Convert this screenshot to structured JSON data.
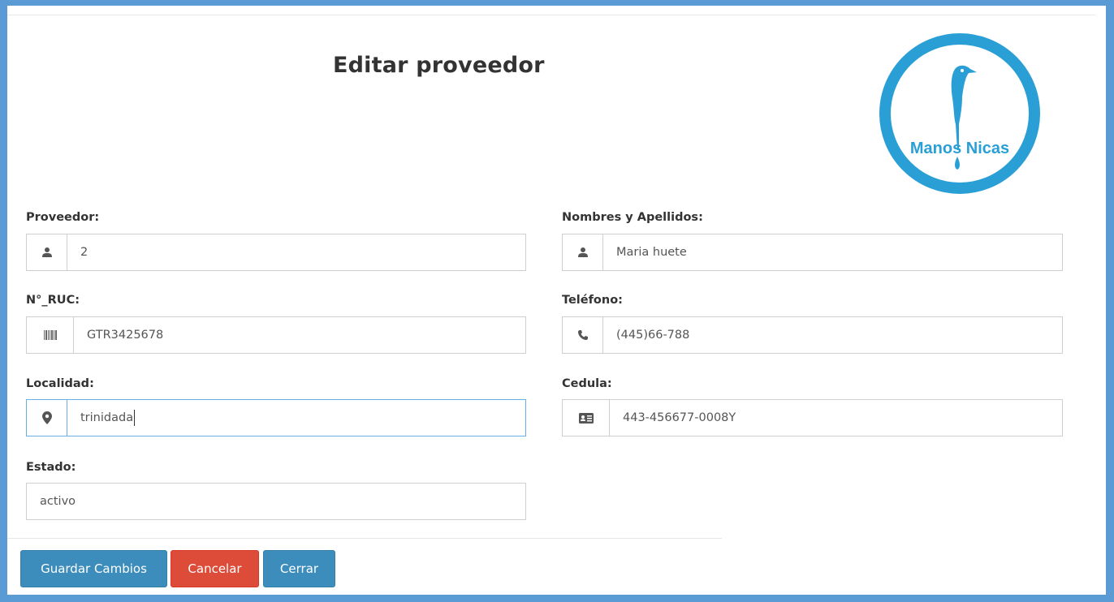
{
  "header": {
    "title": "Editar proveedor",
    "logo_text": "Manos Nicas"
  },
  "form": {
    "proveedor": {
      "label": "Proveedor:",
      "value": "2",
      "icon": "user-icon"
    },
    "nombres": {
      "label": "Nombres y Apellidos:",
      "value": "Maria huete",
      "icon": "user-icon"
    },
    "ruc": {
      "label": "N°_RUC:",
      "value": "GTR3425678",
      "icon": "barcode-icon"
    },
    "telefono": {
      "label": "Teléfono:",
      "value": "(445)66-788",
      "icon": "phone-icon"
    },
    "localidad": {
      "label": "Localidad:",
      "value": "trinidada",
      "icon": "map-marker-icon"
    },
    "cedula": {
      "label": "Cedula:",
      "value": "443-456677-0008Y",
      "icon": "id-card-icon"
    },
    "estado": {
      "label": "Estado:",
      "value": "activo"
    }
  },
  "buttons": {
    "save": "Guardar Cambios",
    "cancel": "Cancelar",
    "close": "Cerrar"
  },
  "colors": {
    "frame": "#5b9bd5",
    "primary": "#3c8dbc",
    "danger": "#dd4b39",
    "logo": "#2a9fd6",
    "focus": "#66afe9"
  }
}
